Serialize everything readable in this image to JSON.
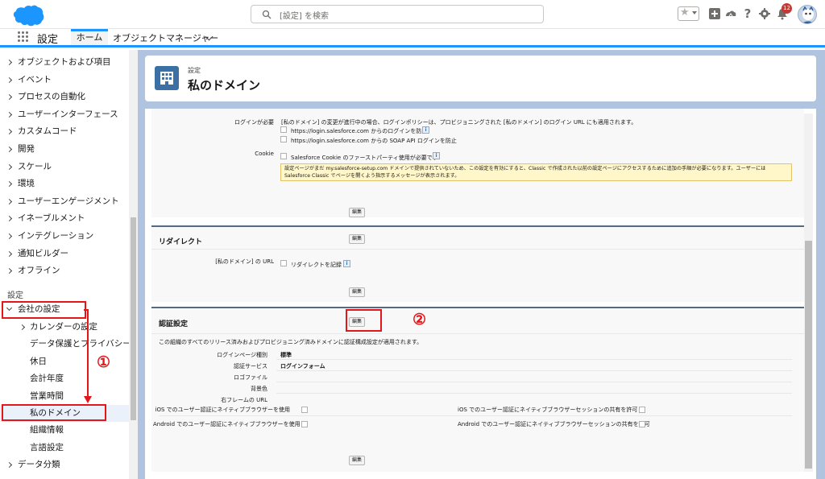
{
  "header": {
    "search_placeholder": "[設定] を検索",
    "notification_count": "12",
    "icons": [
      "salesforce-cloud-logo",
      "search-icon",
      "star-icon",
      "add-icon",
      "trailhead-icon",
      "help-icon",
      "gear-icon",
      "bell-icon",
      "avatar"
    ]
  },
  "nav": {
    "app_name": "設定",
    "tab_home": "ホーム",
    "tab_object_manager": "オブジェクトマネージャー"
  },
  "sidebar": {
    "items_top": [
      "オブジェクトおよび項目",
      "イベント",
      "プロセスの自動化",
      "ユーザーインターフェース",
      "カスタムコード",
      "開発",
      "スケール",
      "環境",
      "ユーザーエンゲージメント",
      "イネーブルメント",
      "インテグレーション",
      "通知ビルダー",
      "オフライン"
    ],
    "section_label": "設定",
    "company_settings": "会社の設定",
    "sub_items": [
      "カレンダーの設定",
      "データ保護とプライバシー",
      "休日",
      "会計年度",
      "営業時間",
      "私のドメイン",
      "組織情報",
      "言語設定"
    ],
    "data_classification": "データ分類"
  },
  "annotations": {
    "marker1": "①",
    "marker2": "②"
  },
  "page": {
    "breadcrumb": "設定",
    "title": "私のドメイン"
  },
  "policies": {
    "login_required_label": "ログインが必要",
    "login_required_desc": "[私のドメイン] の変更が進行中の場合、ログインポリシーは、プロビジョニングされた [私のドメイン] のログイン URL にも適用されます。",
    "opt_prevent_login": "https://login.salesforce.com からのログインを防止",
    "opt_prevent_soap": "https://login.salesforce.com からの SOAP API ログインを防止",
    "cookie_label": "Cookie",
    "cookie_opt": "Salesforce Cookie のファーストパーティ使用が必要です",
    "warning": "設定ページがまだ my.salesforce-setup.com ドメインで提供されていないため、この設定を有効にすると、Classic で作成された以前の設定ページにアクセスするために追加の手順が必要になります。ユーザーには Salesforce Classic でページを開くよう指示するメッセージが表示されます。",
    "edit": "編集"
  },
  "redirect": {
    "title": "リダイレクト",
    "edit": "編集",
    "url_label": "[私のドメイン] の URL",
    "opt_log_redirect": "リダイレクトを記録",
    "edit_bottom": "編集"
  },
  "auth": {
    "title": "認証設定",
    "edit": "編集",
    "desc": "この組織のすべてのリリース済みおよびプロビジョニング済みドメインに認証構成設定が適用されます。",
    "rows": [
      {
        "label": "ログインページ種別",
        "value": "標準"
      },
      {
        "label": "認証サービス",
        "value": "ログインフォーム"
      },
      {
        "label": "ロゴファイル",
        "value": ""
      },
      {
        "label": "背景色",
        "value": ""
      },
      {
        "label": "右フレームの URL",
        "value": ""
      }
    ],
    "ios_browser": "iOS でのユーザー認証にネイティブブラウザーを使用",
    "ios_session": "iOS でのユーザー認証にネイティブブラウザーセッションの共有を許可",
    "android_browser": "Android でのユーザー認証にネイティブブラウザーを使用",
    "android_session": "Android でのユーザー認証にネイティブブラウザーセッションの共有を許可",
    "edit_bottom": "編集"
  },
  "colors": {
    "brand_blue": "#1b96ff",
    "annotation_red": "#e3161a",
    "page_bg": "#b0c4df",
    "section_rule": "#56697f"
  }
}
